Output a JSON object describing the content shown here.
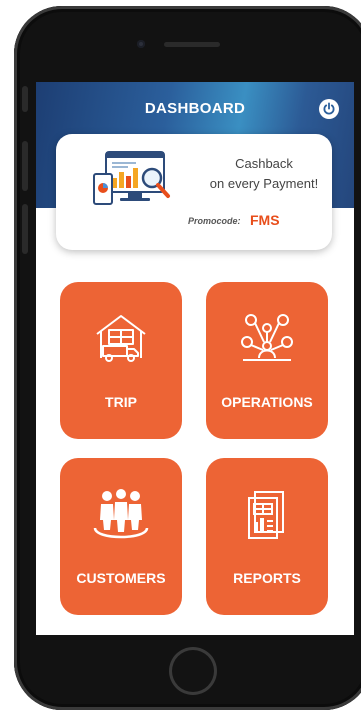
{
  "header": {
    "title": "DASHBOARD"
  },
  "promo": {
    "line1": "Cashback",
    "line2": "on every Payment!",
    "code_label": "Promocode:",
    "code": "FMS"
  },
  "tiles": [
    {
      "label": "TRIP",
      "icon": "truck-warehouse-icon"
    },
    {
      "label": "OPERATIONS",
      "icon": "network-nodes-icon"
    },
    {
      "label": "CUSTOMERS",
      "icon": "people-group-icon"
    },
    {
      "label": "REPORTS",
      "icon": "report-document-icon"
    }
  ],
  "colors": {
    "accent": "#ED6435",
    "promo_code": "#E84E1B",
    "header": "#2B5F9C"
  }
}
